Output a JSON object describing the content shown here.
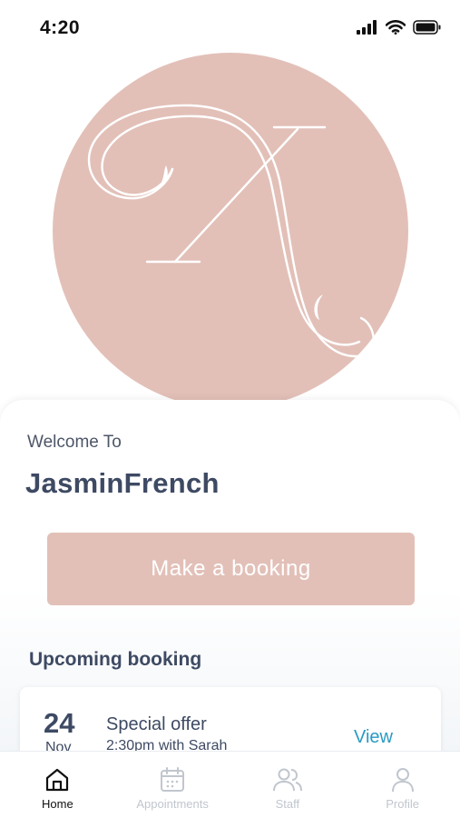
{
  "status_bar": {
    "time": "4:20",
    "icons": [
      "signal-icon",
      "wifi-icon",
      "battery-icon"
    ]
  },
  "logo": {
    "letter": "X",
    "background_color": "#e2c0b8",
    "stroke_color": "#ffffff"
  },
  "welcome": {
    "label": "Welcome To",
    "salon_name": "JasminFrench"
  },
  "booking_button": {
    "label": "Make a booking",
    "color": "#e2c0b8"
  },
  "upcoming": {
    "title": "Upcoming booking",
    "booking": {
      "day": "24",
      "month": "Nov",
      "title": "Special offer",
      "subtitle": "2:30pm with Sarah",
      "action": "View"
    }
  },
  "tab_bar": {
    "tabs": [
      {
        "label": "Home",
        "icon": "home-icon",
        "active": true
      },
      {
        "label": "Appointments",
        "icon": "calendar-icon",
        "active": false
      },
      {
        "label": "Staff",
        "icon": "users-icon",
        "active": false
      },
      {
        "label": "Profile",
        "icon": "user-icon",
        "active": false
      }
    ],
    "active_color": "#111111",
    "inactive_color": "#c1c6ce"
  }
}
